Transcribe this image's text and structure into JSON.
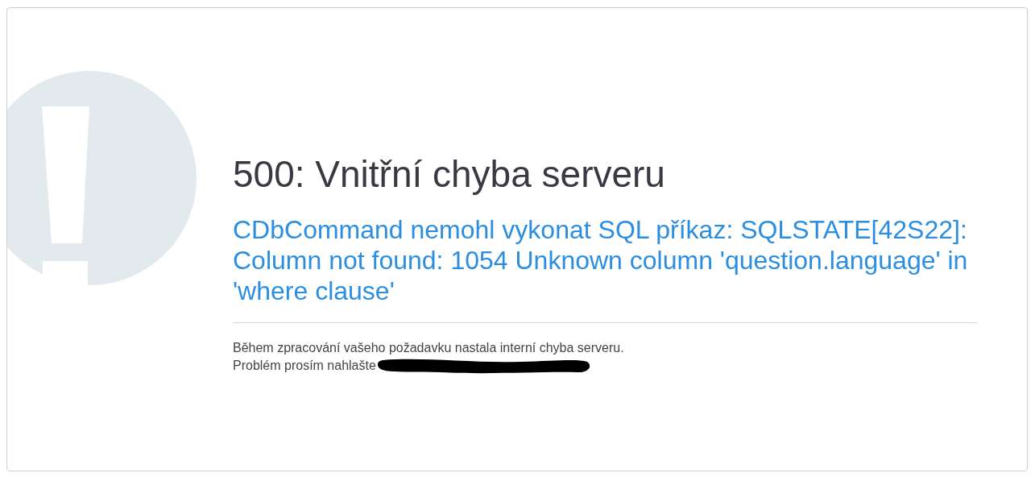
{
  "error": {
    "title": "500: Vnitřní chyba serveru",
    "message": "CDbCommand nemohl vykonat SQL příkaz: SQLSTATE[42S22]: Column not found: 1054 Unknown column 'question.language' in 'where clause'",
    "paragraphs": [
      "Během zpracování vašeho požadavku nastala interní chyba serveru.",
      "Problém prosím nahlašte"
    ]
  }
}
